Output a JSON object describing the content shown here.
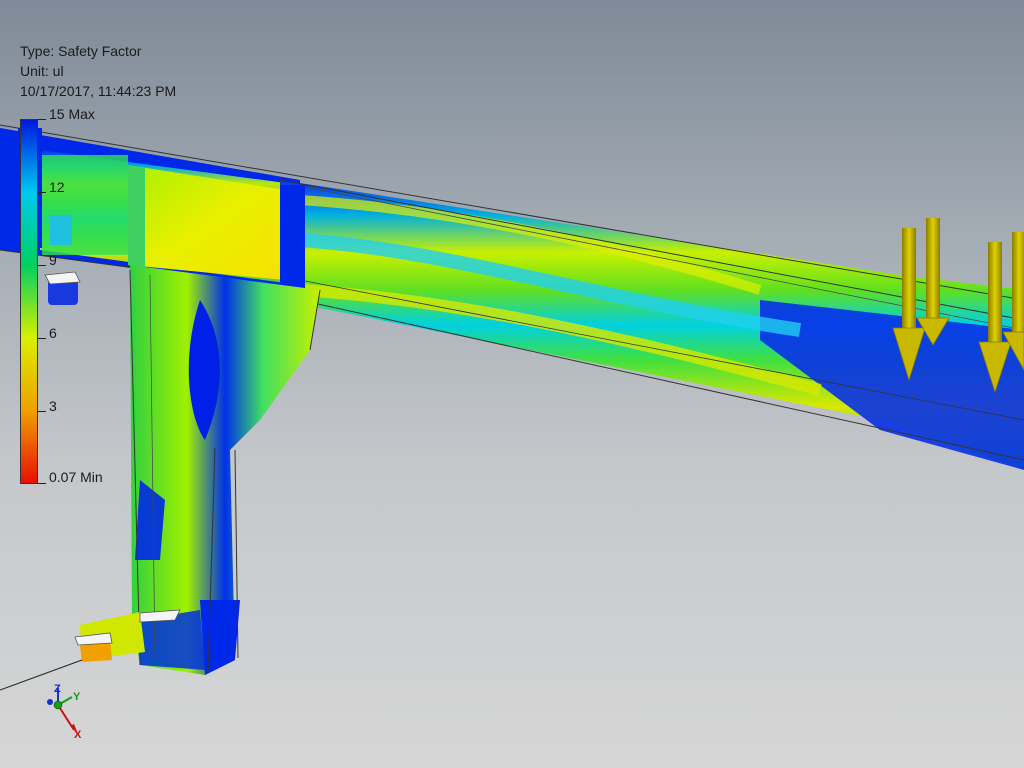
{
  "window": {
    "background_top": "#7e8a98",
    "background_bottom": "#d6d6d6"
  },
  "result_info": {
    "type_line": "Type: Safety Factor",
    "unit_line": "Unit: ul",
    "timestamp_line": "10/17/2017, 11:44:23 PM"
  },
  "legend": {
    "labels": [
      {
        "text": "15 Max"
      },
      {
        "text": "12"
      },
      {
        "text": "9"
      },
      {
        "text": "6"
      },
      {
        "text": "3"
      },
      {
        "text": "0.07 Min"
      }
    ],
    "colors": [
      "#0018e0",
      "#00c8f0",
      "#00d060",
      "#d8f000",
      "#f0a000",
      "#e81000"
    ]
  },
  "loads": {
    "arrow_color": "#c8b800",
    "count": 4
  },
  "triad": {
    "x_label": "X",
    "y_label": "Y",
    "z_label": "Z",
    "x_color": "#d01010",
    "y_color": "#10a010",
    "z_color": "#1030d0"
  }
}
